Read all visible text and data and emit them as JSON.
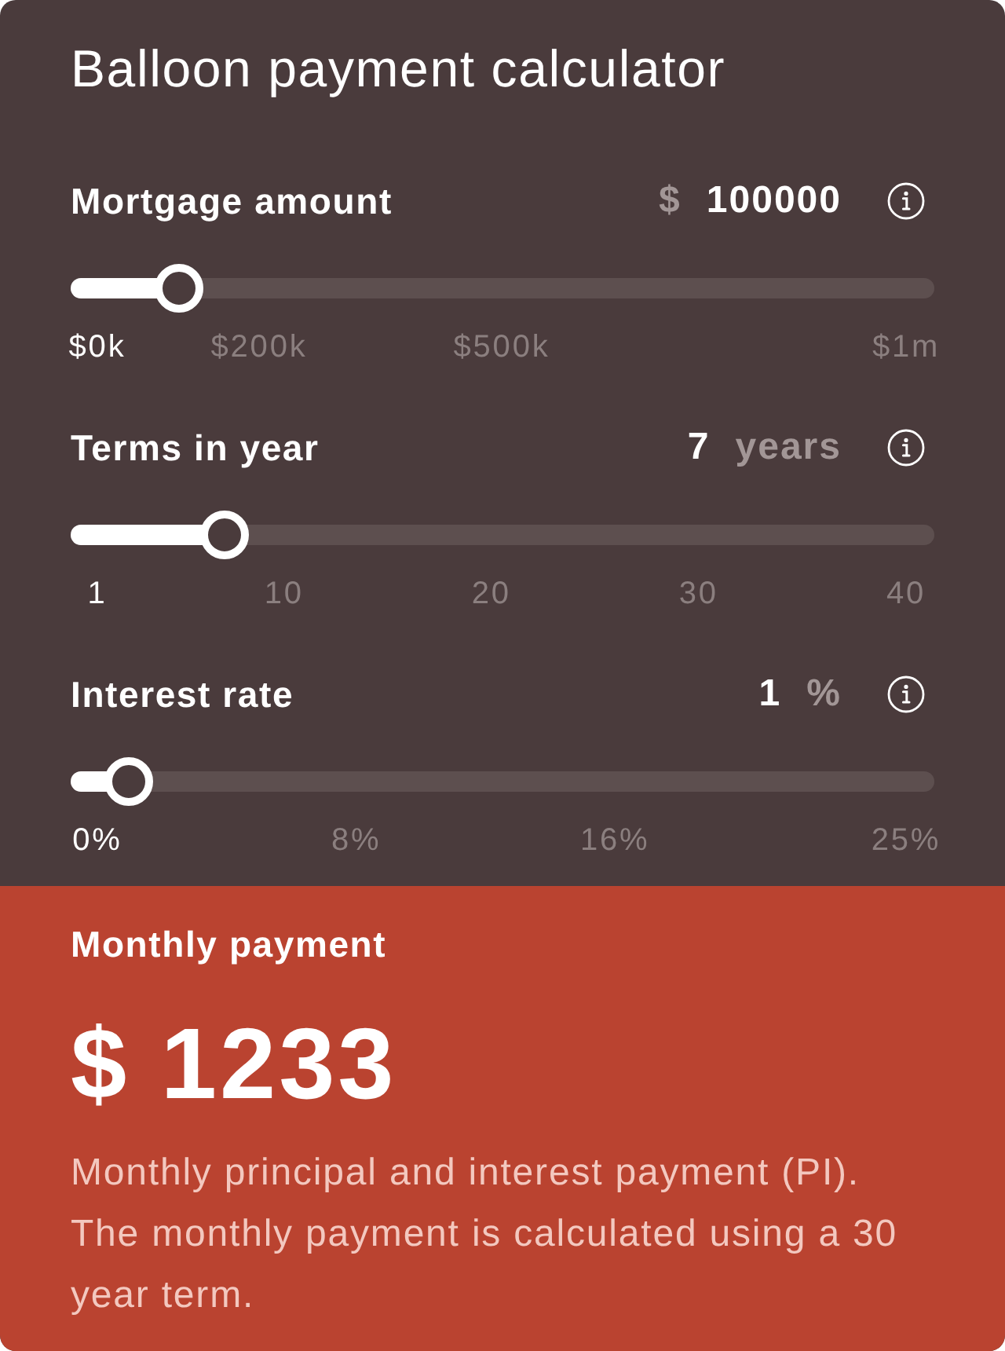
{
  "title": "Balloon payment calculator",
  "sliders": [
    {
      "label": "Mortgage amount",
      "unit_before": "$",
      "value": "100000",
      "level": 0.125,
      "ticks": [
        {
          "label": "$0k",
          "highlighted": true
        },
        {
          "label": "$200k",
          "highlighted": false
        },
        {
          "label": "$500k",
          "highlighted": false
        },
        {
          "label": "$1m",
          "highlighted": false
        }
      ]
    },
    {
      "label": "Terms in year",
      "value": "7",
      "unit_after": "years",
      "level": 0.178,
      "ticks": [
        {
          "label": "1",
          "highlighted": true
        },
        {
          "label": "10",
          "highlighted": false
        },
        {
          "label": "20",
          "highlighted": false
        },
        {
          "label": "30",
          "highlighted": false
        },
        {
          "label": "40",
          "highlighted": false
        }
      ]
    },
    {
      "label": "Interest rate",
      "value": "1",
      "unit_after": "%",
      "level": 0.068,
      "ticks": [
        {
          "label": "0%",
          "highlighted": true
        },
        {
          "label": "8%",
          "highlighted": false
        },
        {
          "label": "16%",
          "highlighted": false
        },
        {
          "label": "25%",
          "highlighted": false
        }
      ]
    }
  ],
  "result": {
    "label": "Monthly payment",
    "amount": "$ 1233",
    "description": "Monthly principal and interest payment (PI). The monthly payment is calculated using a 30 year term."
  }
}
